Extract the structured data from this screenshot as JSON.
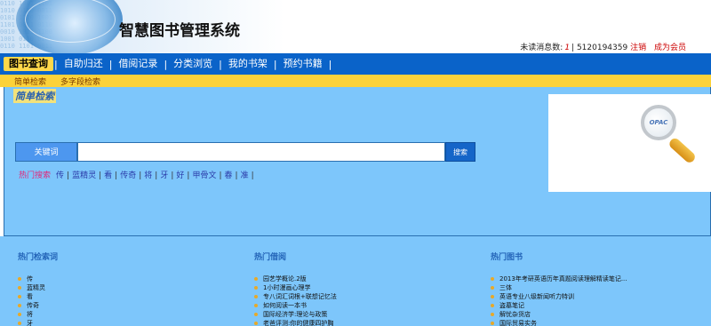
{
  "header": {
    "title": "智慧图书管理系统",
    "unread_label": "未读消息数:",
    "unread_count": "1",
    "user_id": "5120194359",
    "logout": "注销",
    "member": "成为会员"
  },
  "nav": {
    "items": [
      {
        "label": "图书查询"
      },
      {
        "label": "自助归还"
      },
      {
        "label": "借阅记录"
      },
      {
        "label": "分类浏览"
      },
      {
        "label": "我的书架"
      },
      {
        "label": "预约书籍"
      }
    ]
  },
  "subnav": {
    "items": [
      {
        "label": "简单检索"
      },
      {
        "label": "多字段检索"
      }
    ]
  },
  "search": {
    "panel_title": "简单检索",
    "keyword_label": "关键词",
    "keyword_value": "",
    "button_label": "搜索",
    "hot_label": "热门搜索",
    "hot_keywords": [
      "传",
      "蓝精灵",
      "看",
      "传奇",
      "将",
      "牙",
      "好",
      "甲骨文",
      "春",
      "准"
    ],
    "opac_text": "OPAC"
  },
  "columns": {
    "hot_search": {
      "title": "热门检索词",
      "items": [
        "传",
        "蓝精灵",
        "看",
        "传奇",
        "将",
        "牙"
      ]
    },
    "hot_borrow": {
      "title": "热门借阅",
      "items": [
        "园艺学概论.2版",
        "1小时漫画心理学",
        "专八词汇词根+联想记忆法",
        "如何阅读一本书",
        "国际经济学:理论与政策",
        "老爸评测:你的健康四护胸"
      ]
    },
    "hot_books": {
      "title": "热门图书",
      "items": [
        "2013年考研英语历年真题阅读理解精读笔记...",
        "三体",
        "英语专业八级新闻听力特训",
        "盗墓笔记",
        "解忧杂货店",
        "国际贸易实务"
      ]
    }
  },
  "colors": {
    "nav_bg": "#0a63c9",
    "subnav_bg": "#fcd23a",
    "panel_bg": "#7dc6fb",
    "active_tab": "#ffd84a"
  }
}
